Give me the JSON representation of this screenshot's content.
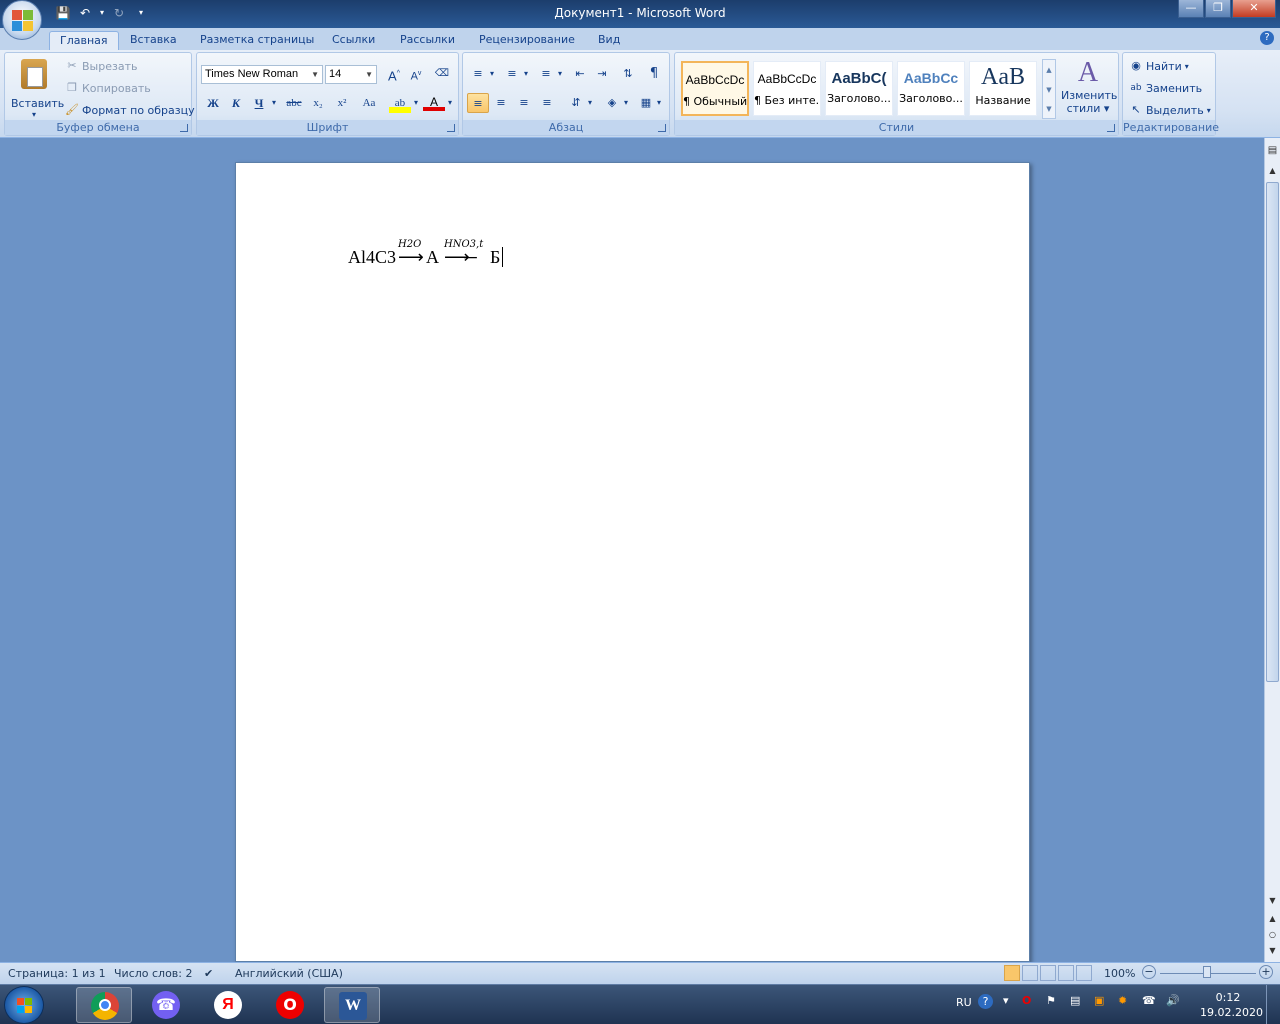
{
  "window": {
    "title": "Документ1 - Microsoft Word"
  },
  "tabs": [
    "Главная",
    "Вставка",
    "Разметка страницы",
    "Ссылки",
    "Рассылки",
    "Рецензирование",
    "Вид"
  ],
  "clipboard": {
    "paste": "Вставить",
    "cut": "Вырезать",
    "copy": "Копировать",
    "format_painter": "Формат по образцу",
    "label": "Буфер обмена"
  },
  "font": {
    "name": "Times New Roman",
    "size": "14",
    "bold": "Ж",
    "italic": "К",
    "underline": "Ч",
    "strike": "abc",
    "subscript": "x₂",
    "superscript": "x²",
    "change_case": "Aa",
    "label": "Шрифт"
  },
  "paragraph": {
    "label": "Абзац"
  },
  "styles": {
    "items": [
      {
        "sample": "AaBbCcDc",
        "name": "¶ Обычный"
      },
      {
        "sample": "AaBbCcDc",
        "name": "¶ Без инте..."
      },
      {
        "sample": "AaBbC(",
        "name": "Заголово..."
      },
      {
        "sample": "AaBbCc",
        "name": "Заголово..."
      },
      {
        "sample": "AaB",
        "name": "Название"
      }
    ],
    "change_styles_line1": "Изменить",
    "change_styles_line2": "стили",
    "label": "Стили"
  },
  "editing": {
    "find": "Найти",
    "replace": "Заменить",
    "select": "Выделить",
    "label": "Редактирование"
  },
  "document": {
    "formula_part1": "Al4C3",
    "arrow1": "⟶",
    "arrow1_over": "H2O",
    "product_a": "A",
    "arrow2": "⟶",
    "arrow2_over": "HNO3,t",
    "product_b": "Б"
  },
  "status": {
    "page": "Страница: 1 из 1",
    "words": "Число слов: 2",
    "language": "Английский (США)",
    "zoom": "100%"
  },
  "taskbar": {
    "lang": "RU",
    "time": "0:12",
    "date": "19.02.2020"
  }
}
